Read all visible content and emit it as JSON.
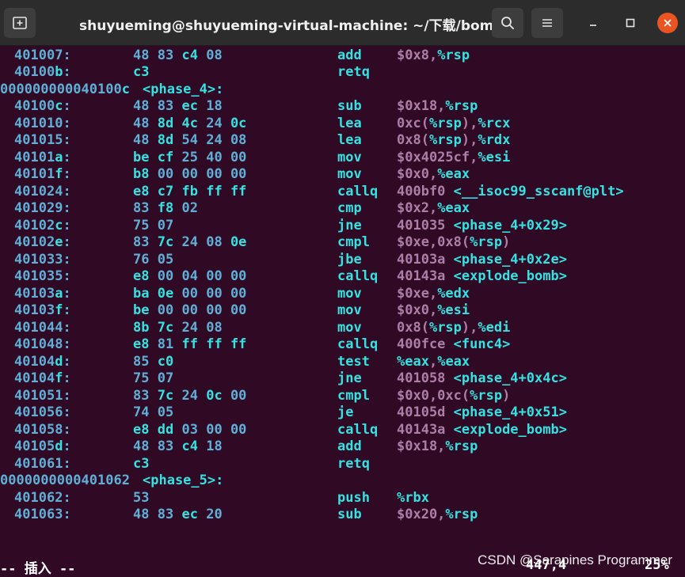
{
  "window": {
    "title": "shuyueming@shuyueming-virtual-machine: ~/下载/bomb",
    "buttons": {
      "new_tab_icon": "new-tab-icon",
      "search_icon": "search-icon",
      "menu_icon": "hamburger-menu-icon",
      "minimize_icon": "minimize-icon",
      "maximize_icon": "maximize-icon",
      "close_icon": "close-icon"
    }
  },
  "colors": {
    "background": "#300a24",
    "address": "#5fafd7",
    "bytes": "#5fafd7",
    "hex_white": "#ffffff",
    "mnemonic": "#34e2e2",
    "operand_reg": "#34e2e2",
    "operand_other": "#ad7fa8",
    "label": "#34e2e2",
    "close_button": "#e95420"
  },
  "lines": [
    {
      "addr": "401007:",
      "bytes": "48 83 c4 08",
      "mn": "add",
      "ops": "$0x8,%rsp"
    },
    {
      "addr": "40100b:",
      "bytes": "c3",
      "mn": "retq",
      "ops": ""
    },
    {
      "header": "000000000040100c",
      "label": "<phase_4>:"
    },
    {
      "addr": "40100c:",
      "bytes": "48 83 ec 18",
      "mn": "sub",
      "ops": "$0x18,%rsp"
    },
    {
      "addr": "401010:",
      "bytes": "48 8d 4c 24 0c",
      "mn": "lea",
      "ops": "0xc(%rsp),%rcx"
    },
    {
      "addr": "401015:",
      "bytes": "48 8d 54 24 08",
      "mn": "lea",
      "ops": "0x8(%rsp),%rdx"
    },
    {
      "addr": "40101a:",
      "bytes": "be cf 25 40 00",
      "mn": "mov",
      "ops": "$0x4025cf,%esi"
    },
    {
      "addr": "40101f:",
      "bytes": "b8 00 00 00 00",
      "mn": "mov",
      "ops": "$0x0,%eax"
    },
    {
      "addr": "401024:",
      "bytes": "e8 c7 fb ff ff",
      "mn": "callq",
      "ops": "400bf0 <__isoc99_sscanf@plt>"
    },
    {
      "addr": "401029:",
      "bytes": "83 f8 02",
      "mn": "cmp",
      "ops": "$0x2,%eax"
    },
    {
      "addr": "40102c:",
      "bytes": "75 07",
      "mn": "jne",
      "ops": "401035 <phase_4+0x29>"
    },
    {
      "addr": "40102e:",
      "bytes": "83 7c 24 08 0e",
      "mn": "cmpl",
      "ops": "$0xe,0x8(%rsp)"
    },
    {
      "addr": "401033:",
      "bytes": "76 05",
      "mn": "jbe",
      "ops": "40103a <phase_4+0x2e>"
    },
    {
      "addr": "401035:",
      "bytes": "e8 00 04 00 00",
      "mn": "callq",
      "ops": "40143a <explode_bomb>"
    },
    {
      "addr": "40103a:",
      "bytes": "ba 0e 00 00 00",
      "mn": "mov",
      "ops": "$0xe,%edx"
    },
    {
      "addr": "40103f:",
      "bytes": "be 00 00 00 00",
      "mn": "mov",
      "ops": "$0x0,%esi"
    },
    {
      "addr": "401044:",
      "bytes": "8b 7c 24 08",
      "mn": "mov",
      "ops": "0x8(%rsp),%edi"
    },
    {
      "addr": "401048:",
      "bytes": "e8 81 ff ff ff",
      "mn": "callq",
      "ops": "400fce <func4>"
    },
    {
      "addr": "40104d:",
      "bytes": "85 c0",
      "mn": "test",
      "ops": "%eax,%eax"
    },
    {
      "addr": "40104f:",
      "bytes": "75 07",
      "mn": "jne",
      "ops": "401058 <phase_4+0x4c>"
    },
    {
      "addr": "401051:",
      "bytes": "83 7c 24 0c 00",
      "mn": "cmpl",
      "ops": "$0x0,0xc(%rsp)"
    },
    {
      "addr": "401056:",
      "bytes": "74 05",
      "mn": "je",
      "ops": "40105d <phase_4+0x51>"
    },
    {
      "addr": "401058:",
      "bytes": "e8 dd 03 00 00",
      "mn": "callq",
      "ops": "40143a <explode_bomb>"
    },
    {
      "addr": "40105d:",
      "bytes": "48 83 c4 18",
      "mn": "add",
      "ops": "$0x18,%rsp"
    },
    {
      "addr": "401061:",
      "bytes": "c3",
      "mn": "retq",
      "ops": ""
    },
    {
      "header": "0000000000401062",
      "label": "<phase_5>:"
    },
    {
      "addr": "401062:",
      "bytes": "53",
      "mn": "push",
      "ops": "%rbx"
    },
    {
      "addr": "401063:",
      "bytes": "48 83 ec 20",
      "mn": "sub",
      "ops": "$0x20,%rsp"
    }
  ],
  "status": {
    "mode": "-- 插入 --",
    "cursor": "447,4",
    "percent": "25%"
  },
  "watermark": "CSDN @Sarapines Programmer"
}
